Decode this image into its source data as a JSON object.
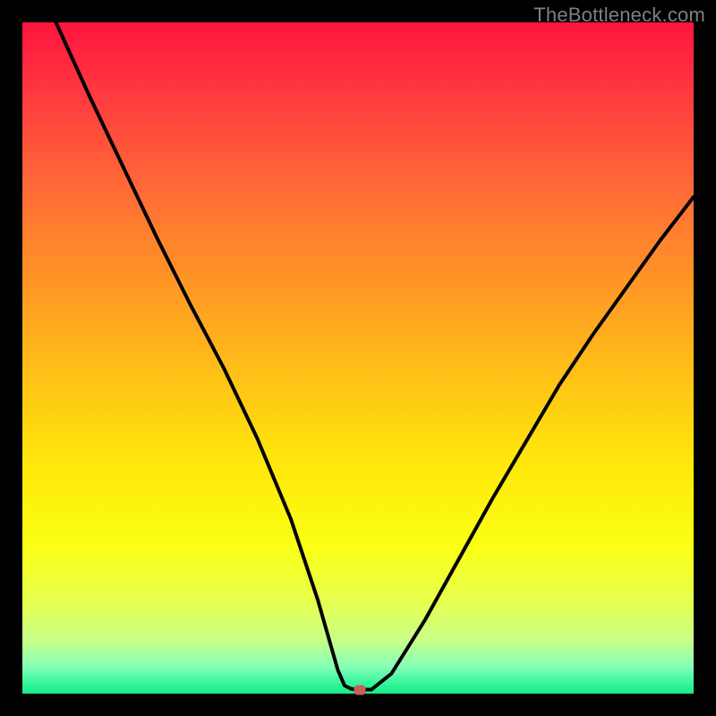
{
  "watermark": "TheBottleneck.com",
  "chart_data": {
    "type": "line",
    "title": "",
    "xlabel": "",
    "ylabel": "",
    "xlim": [
      0,
      100
    ],
    "ylim": [
      0,
      100
    ],
    "series": [
      {
        "name": "curve",
        "x": [
          5,
          10,
          15,
          20,
          25,
          30,
          35,
          40,
          42,
          44,
          46,
          47,
          48,
          49,
          50,
          52,
          55,
          60,
          65,
          70,
          75,
          80,
          85,
          90,
          95,
          100
        ],
        "values": [
          100,
          89,
          78.5,
          68,
          58,
          48.5,
          38,
          26,
          20,
          14,
          7,
          3.5,
          1.2,
          0.7,
          0.6,
          0.6,
          3,
          11,
          20,
          29,
          37.5,
          46,
          53.5,
          60.5,
          67.5,
          74
        ]
      }
    ],
    "marker": {
      "x": 50.2,
      "y": 0.6
    },
    "colors": {
      "curve": "#000000",
      "marker": "#cb5e56",
      "gradient_top": "#ff143e",
      "gradient_bottom": "#18e985"
    }
  }
}
